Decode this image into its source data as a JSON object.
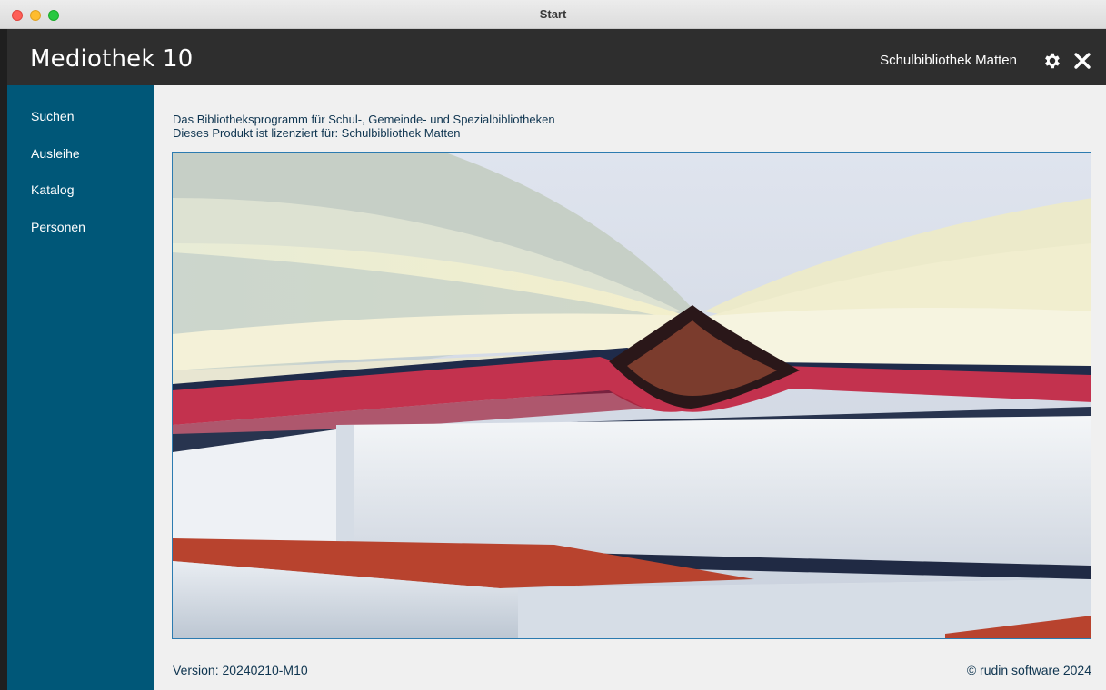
{
  "window": {
    "title": "Start"
  },
  "header": {
    "app_title": "Mediothek 10",
    "library_name": "Schulbibliothek Matten",
    "icons": [
      "gear-icon",
      "close-icon"
    ]
  },
  "sidebar": {
    "items": [
      {
        "label": "Suchen"
      },
      {
        "label": "Ausleihe"
      },
      {
        "label": "Katalog"
      },
      {
        "label": "Personen"
      }
    ]
  },
  "main": {
    "description_line1": "Das Bibliotheksprogramm für Schul-, Gemeinde- und Spezialbibliotheken",
    "description_line2": "Dieses Produkt ist lizenziert für: Schulbibliothek Matten",
    "version": "Version: 20240210-M10",
    "copyright": "© rudin software 2024"
  },
  "colors": {
    "header_bg": "#2e2e2e",
    "sidebar_bg": "#005778",
    "content_bg": "#f0f0f0",
    "text_dark_blue": "#0f3550",
    "image_border": "#2c7bb0"
  }
}
